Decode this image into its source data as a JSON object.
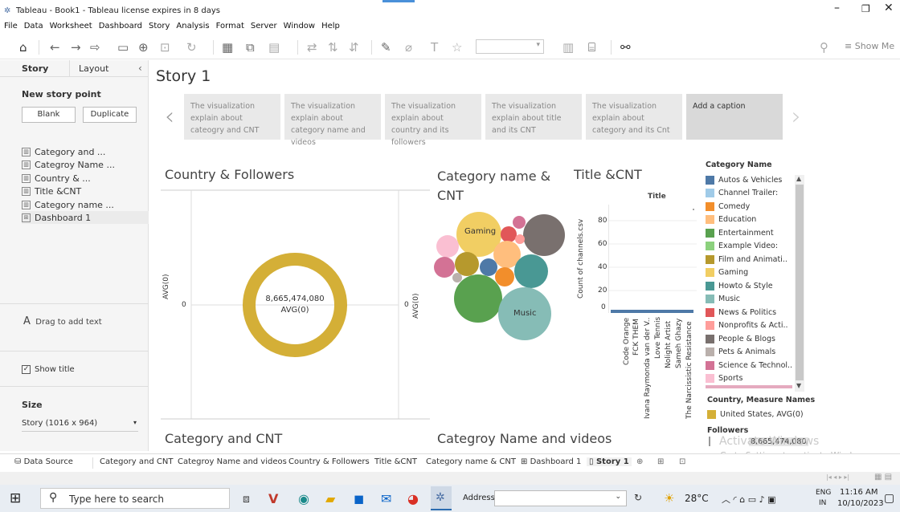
{
  "window": {
    "title": "Tableau - Book1 - Tableau license expires in 8 days"
  },
  "menu": [
    "File",
    "Data",
    "Worksheet",
    "Dashboard",
    "Story",
    "Analysis",
    "Format",
    "Server",
    "Window",
    "Help"
  ],
  "toolbar": {
    "show_me": "Show Me"
  },
  "left_panel": {
    "tab_story": "Story",
    "tab_layout": "Layout",
    "new_story_point": "New story point",
    "blank": "Blank",
    "duplicate": "Duplicate",
    "items": [
      "Category and ...",
      "Categroy Name ...",
      "Country & ...",
      "Title &CNT",
      "Category name ...",
      "Dashboard 1"
    ],
    "drag_text": "Drag to add text",
    "show_title": "Show title",
    "size_label": "Size",
    "size_value": "Story (1016 x 964)"
  },
  "story": {
    "title": "Story 1",
    "points": [
      "The visualization explain about cateogry and CNT",
      "The visualization explain about category name and videos",
      "The visualization explain about country and its followers",
      "The visualization explain about title and its CNT",
      "The visualization explain about category and its Cnt",
      "Add a caption"
    ]
  },
  "sheets": {
    "country_followers": {
      "title": "Country & Followers",
      "axis_label": "AVG(0)",
      "left_tick": "0",
      "right_tick": "0",
      "center_value": "8,665,474,080",
      "center_label": "AVG(0)"
    },
    "category_name_cnt": {
      "title": "Category name & CNT",
      "bubble_gaming": "Gaming",
      "bubble_music": "Music"
    },
    "title_cnt": {
      "title": "Title &CNT",
      "col_header": "Title",
      "ylabel": "Count of channels.csv",
      "yticks": [
        "80",
        "60",
        "40",
        "20",
        "0"
      ],
      "xticks": [
        "Code Orange",
        "FCK THEM",
        "Ivana Raymonda van der V..",
        "Love Tennis",
        "Nolight Artist",
        "Sameh Ghazy",
        "The Narcissistic Resistance"
      ]
    },
    "category_cnt": {
      "title": "Category and CNT"
    },
    "category_videos": {
      "title": "Categroy Name and videos"
    }
  },
  "legend": {
    "title": "Category Name",
    "items": [
      {
        "label": "Autos & Vehicles",
        "color": "#4e79a7"
      },
      {
        "label": "Channel Trailer:",
        "color": "#a0cbe8"
      },
      {
        "label": "Comedy",
        "color": "#f28e2b"
      },
      {
        "label": "Education",
        "color": "#ffbe7d"
      },
      {
        "label": "Entertainment",
        "color": "#59a14f"
      },
      {
        "label": "Example Video:",
        "color": "#8cd17d"
      },
      {
        "label": "Film and Animati..",
        "color": "#b6992d"
      },
      {
        "label": "Gaming",
        "color": "#f1ce63"
      },
      {
        "label": "Howto & Style",
        "color": "#499894"
      },
      {
        "label": "Music",
        "color": "#86bcb6"
      },
      {
        "label": "News & Politics",
        "color": "#e15759"
      },
      {
        "label": "Nonprofits & Acti..",
        "color": "#ff9d9a"
      },
      {
        "label": "People & Blogs",
        "color": "#79706e"
      },
      {
        "label": "Pets & Animals",
        "color": "#bab0ac"
      },
      {
        "label": "Science & Technol..",
        "color": "#d37295"
      },
      {
        "label": "Sports",
        "color": "#fabfd2"
      }
    ],
    "country_title": "Country, Measure Names",
    "country_item": "United States, AVG(0)",
    "country_color": "#d4af37",
    "followers_title": "Followers",
    "followers_value": "8,665,474,080"
  },
  "sheet_tabs": [
    "Data Source",
    "Category and CNT",
    "Categroy Name and videos",
    "Country & Followers",
    "Title &CNT",
    "Category name & CNT",
    "Dashboard 1",
    "Story 1"
  ],
  "watermark": {
    "line1": "Activate Windows",
    "line2": "Go to Settings to activate Windows."
  },
  "taskbar": {
    "search": "Type here to search",
    "address": "Address",
    "weather": "28°C",
    "lang1": "ENG",
    "lang2": "IN",
    "time": "11:16 AM",
    "date": "10/10/2023"
  }
}
